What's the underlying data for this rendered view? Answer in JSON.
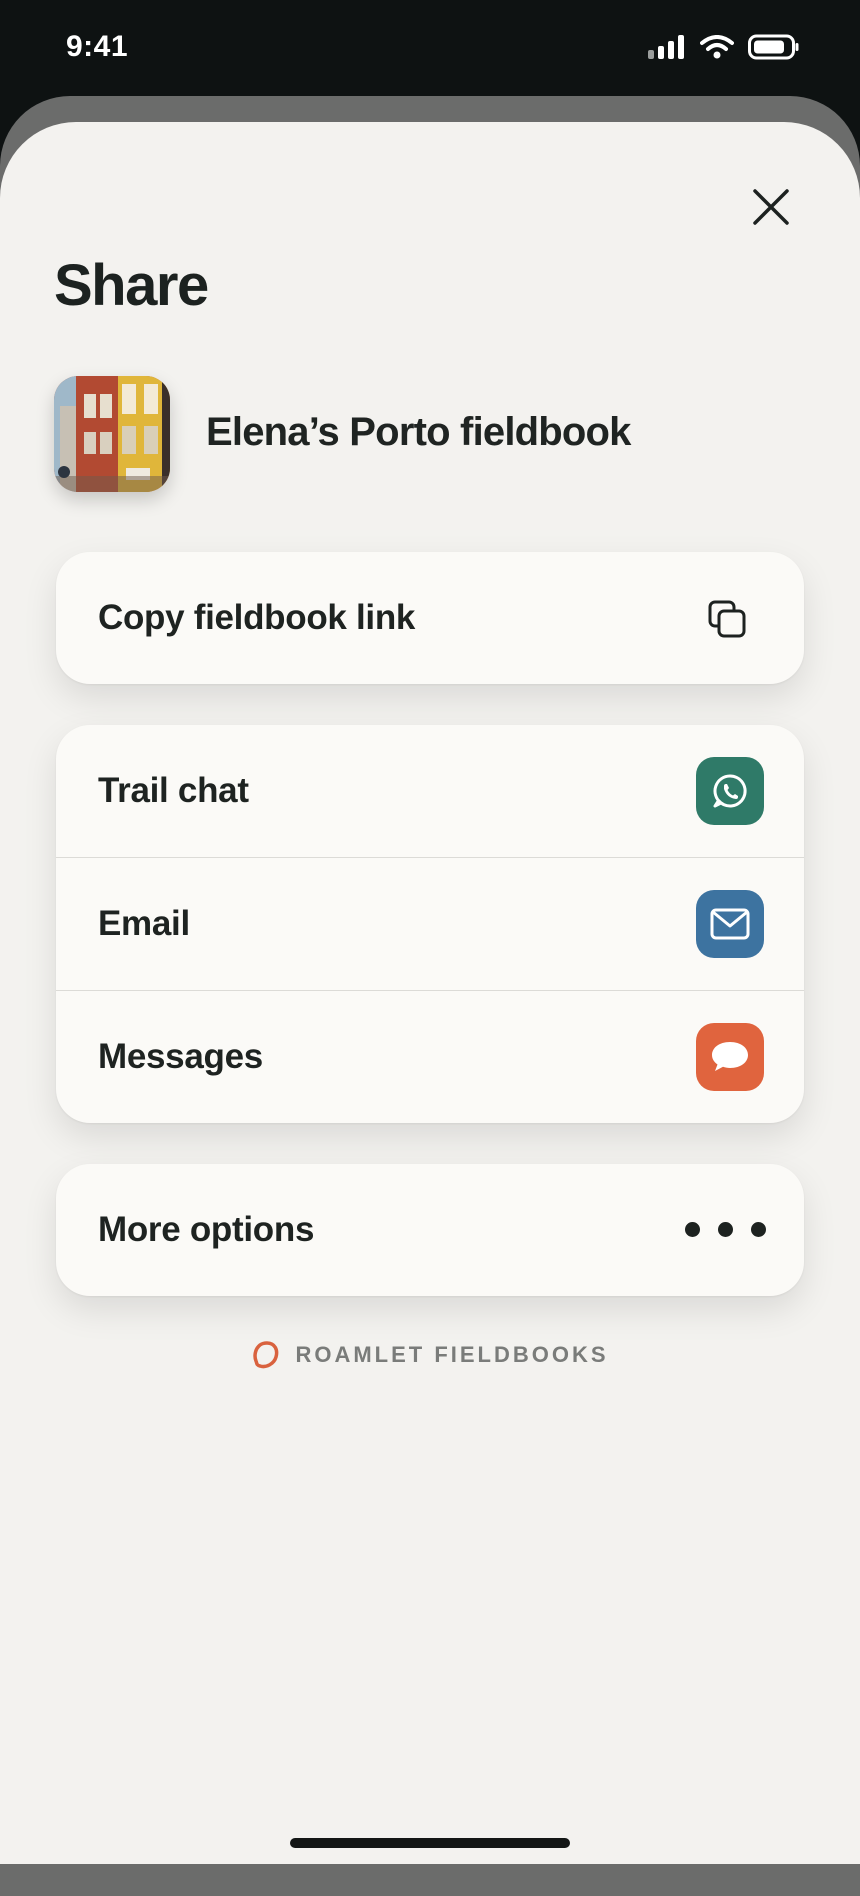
{
  "status_bar": {
    "time": "9:41"
  },
  "sheet": {
    "title": "Share",
    "fieldbook": {
      "name": "Elena’s Porto fieldbook",
      "thumbnail": "porto-street-photo"
    },
    "copy_link": {
      "label": "Copy fieldbook link",
      "icon": "copy-icon"
    },
    "share_targets": [
      {
        "label": "Trail chat",
        "icon": "whatsapp-icon",
        "color": "#2f7a68"
      },
      {
        "label": "Email",
        "icon": "mail-icon",
        "color": "#3d73a0"
      },
      {
        "label": "Messages",
        "icon": "chat-bubble-icon",
        "color": "#e0643e"
      }
    ],
    "more_options": {
      "label": "More options",
      "icon": "more-icon"
    },
    "brand": {
      "text": "ROAMLET FIELDBOOKS",
      "color": "#d9623e"
    }
  },
  "colors": {
    "background": "#f3f2ef",
    "card": "#fbfaf7",
    "text": "#1e2321"
  }
}
